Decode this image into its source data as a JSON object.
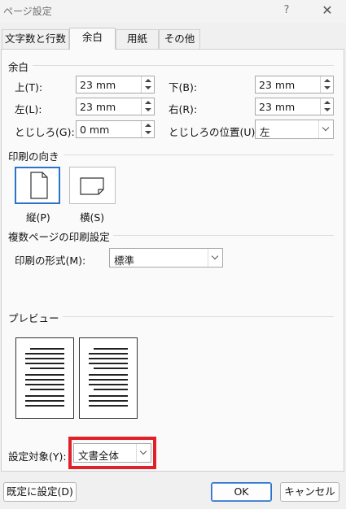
{
  "window": {
    "title": "ページ設定",
    "help_label": "?",
    "close_label": "✕"
  },
  "tabs": [
    {
      "label": "文字数と行数"
    },
    {
      "label": "余白"
    },
    {
      "label": "用紙"
    },
    {
      "label": "その他"
    }
  ],
  "active_tab": "余白",
  "margins": {
    "section_label": "余白",
    "top": {
      "label": "上(T):",
      "value": "23 mm"
    },
    "bottom": {
      "label": "下(B):",
      "value": "23 mm"
    },
    "left": {
      "label": "左(L):",
      "value": "23 mm"
    },
    "right": {
      "label": "右(R):",
      "value": "23 mm"
    },
    "gutter": {
      "label": "とじしろ(G):",
      "value": "0 mm"
    },
    "gutter_pos": {
      "label": "とじしろの位置(U):",
      "value": "左"
    }
  },
  "orientation": {
    "section_label": "印刷の向き",
    "portrait_label": "縦(P)",
    "landscape_label": "横(S)",
    "selected": "portrait"
  },
  "multiple_pages": {
    "section_label": "複数ページの印刷設定",
    "format_label": "印刷の形式(M):",
    "format_value": "標準"
  },
  "preview": {
    "section_label": "プレビュー"
  },
  "apply_to": {
    "label": "設定対象(Y):",
    "value": "文書全体"
  },
  "buttons": {
    "set_default": "既定に設定(D)",
    "ok": "OK",
    "cancel": "キャンセル"
  },
  "colors": {
    "highlight_border": "#e0202a",
    "selection_blue": "#2a73c8"
  }
}
